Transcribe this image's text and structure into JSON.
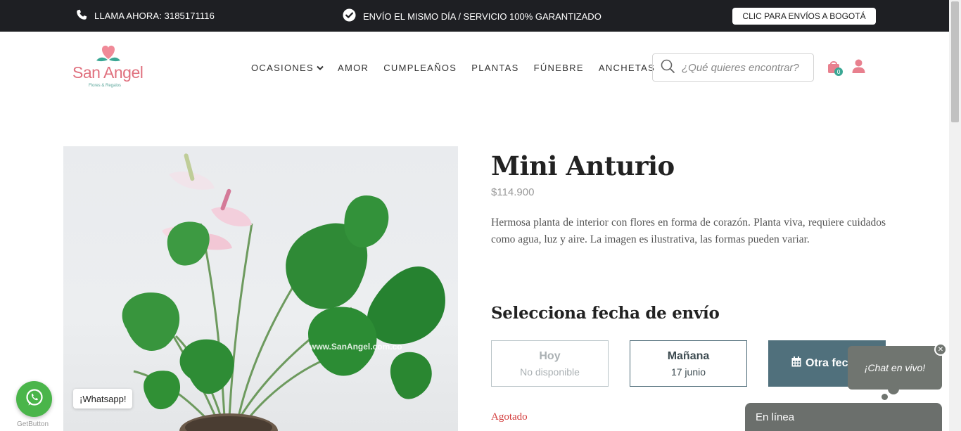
{
  "topbar": {
    "call_label": "LLAMA AHORA: 3185171116",
    "ship_label": "ENVÍO EL MISMO DÍA / SERVICIO 100% GARANTIZADO",
    "bogota_button": "CLIC PARA ENVÍOS A BOGOTÁ"
  },
  "logo": {
    "brand": "San Angel",
    "tagline": "Flores & Regalos"
  },
  "nav": {
    "items": [
      "OCASIONES",
      "AMOR",
      "CUMPLEAÑOS",
      "PLANTAS",
      "FÚNEBRE",
      "ANCHETAS"
    ]
  },
  "search": {
    "placeholder": "¿Qué quieres encontrar?"
  },
  "cart": {
    "count": "0"
  },
  "product": {
    "title": "Mini Anturio",
    "price": "$114.900",
    "description": "Hermosa planta de interior con flores en forma de corazón. Planta viva, requiere cuidados como agua, luz y aire. La imagen es ilustrativa, las formas pueden variar.",
    "watermark": "www.SanAngel.com.co",
    "date_heading": "Selecciona fecha de envío",
    "options": {
      "hoy": {
        "label": "Hoy",
        "sub": "No disponible"
      },
      "manana": {
        "label": "Mañana",
        "sub": "17 junio"
      },
      "otra": {
        "label": "Otra fecha"
      }
    },
    "stock_status": "Agotado"
  },
  "widgets": {
    "whatsapp_tip": "¡Whatsapp!",
    "getbutton": "GetButton",
    "chat_bubble": "¡Chat en vivo!",
    "chat_bar": "En línea"
  },
  "colors": {
    "topbar": "#1e1f23",
    "brand_pink": "#e0707e",
    "teal": "#3aa794",
    "otra_bg": "#50707c",
    "whatsapp": "#4ab54a",
    "agotado": "#d33c3c"
  }
}
